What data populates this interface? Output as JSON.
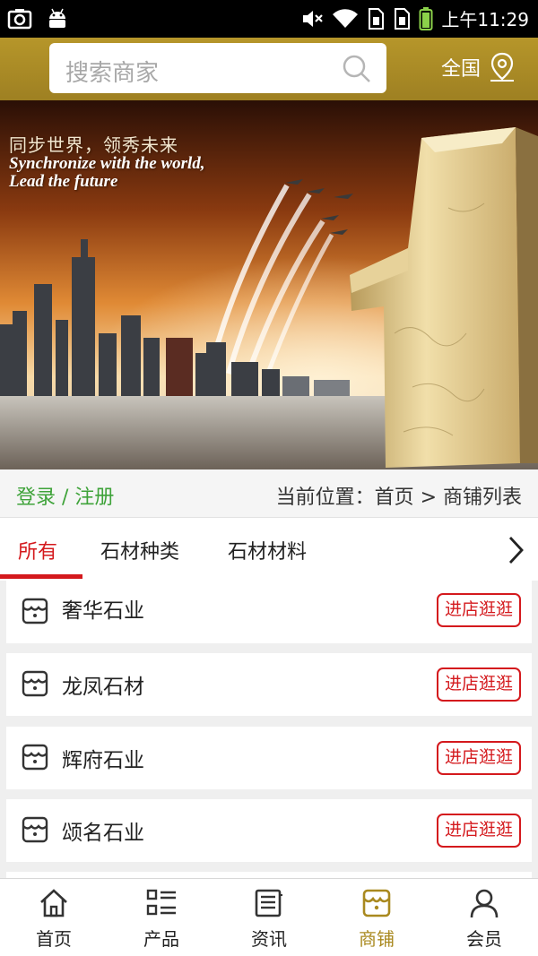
{
  "status_bar": {
    "time": "上午11:29"
  },
  "header": {
    "search_placeholder": "搜索商家",
    "region": "全国"
  },
  "banner": {
    "slogan_cn": "同步世界，领秀未来",
    "slogan_en_line1": "Synchronize with the world,",
    "slogan_en_line2": "Lead the future"
  },
  "breadcrumb": {
    "login": "登录 / 注册",
    "location": "当前位置：首页 > 商铺列表"
  },
  "tabs": [
    {
      "label": "所有",
      "active": true
    },
    {
      "label": "石材种类",
      "active": false
    },
    {
      "label": "石材材料",
      "active": false
    }
  ],
  "shops": [
    {
      "name": "奢华石业",
      "button": "进店逛逛"
    },
    {
      "name": "龙凤石材",
      "button": "进店逛逛"
    },
    {
      "name": "辉府石业",
      "button": "进店逛逛"
    },
    {
      "name": "颂名石业",
      "button": "进店逛逛"
    }
  ],
  "bottom_nav": [
    {
      "label": "首页",
      "icon": "home-icon",
      "active": false
    },
    {
      "label": "产品",
      "icon": "product-list-icon",
      "active": false
    },
    {
      "label": "资讯",
      "icon": "news-icon",
      "active": false
    },
    {
      "label": "商铺",
      "icon": "shop-icon",
      "active": true
    },
    {
      "label": "会员",
      "icon": "member-icon",
      "active": false
    }
  ],
  "colors": {
    "header_gold": "#b6962a",
    "accent_red": "#d4191d",
    "login_green": "#3fa33a",
    "active_nav": "#a9891f"
  }
}
